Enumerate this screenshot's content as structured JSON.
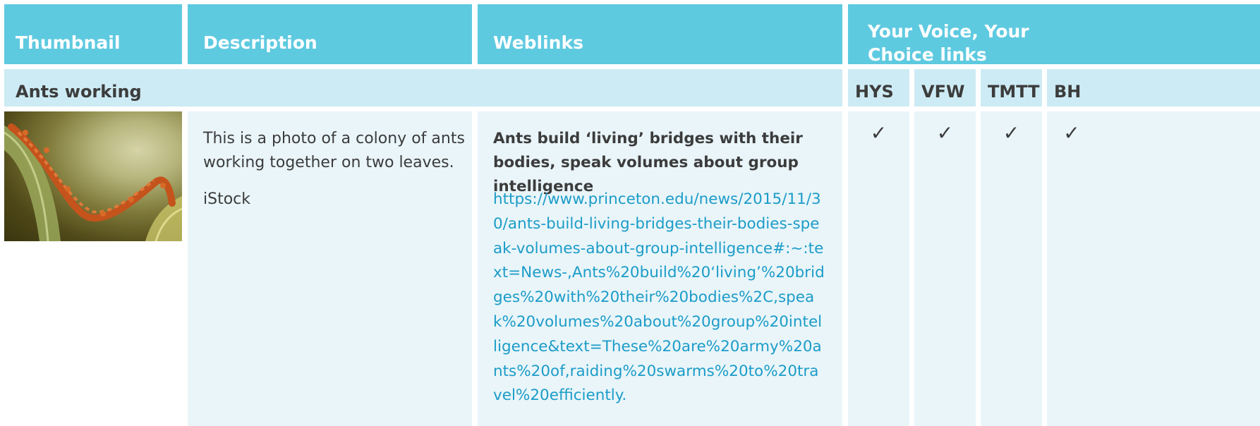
{
  "headers": {
    "thumbnail": "Thumbnail",
    "description": "Description",
    "weblinks": "Weblinks",
    "your_voice": "Your Voice, Your Choice links"
  },
  "row": {
    "title": "Ants working",
    "link_codes": [
      "HYS",
      "VFW",
      "TMTT",
      "BH"
    ],
    "thumbnail_icon": "ants-bridge-photo",
    "description": "This is a photo of a colony of ants working together on two leaves.",
    "credit": "iStock",
    "weblink_title": "Ants build ‘living’ bridges with their bodies, speak volumes about group intelligence",
    "weblink_url": "https://www.princeton.edu/news/2015/11/30/ants-build-living-bridges-their-bodies-speak-volumes-about-group-intelligence#:~:text=News-,Ants%20build%20‘living’%20bridges%20with%20their%20bodies%2C,speak%20volumes%20about%20group%20intelligence&text=These%20are%20army%20ants%20of,raiding%20swarms%20to%20travel%20efficiently.",
    "checks": [
      "✓",
      "✓",
      "✓",
      "✓"
    ]
  },
  "colors": {
    "header_bg": "#5ecae0",
    "subheader_bg": "#cdebf4",
    "body_bg": "#e9f5f9",
    "link": "#1c9cc8"
  }
}
